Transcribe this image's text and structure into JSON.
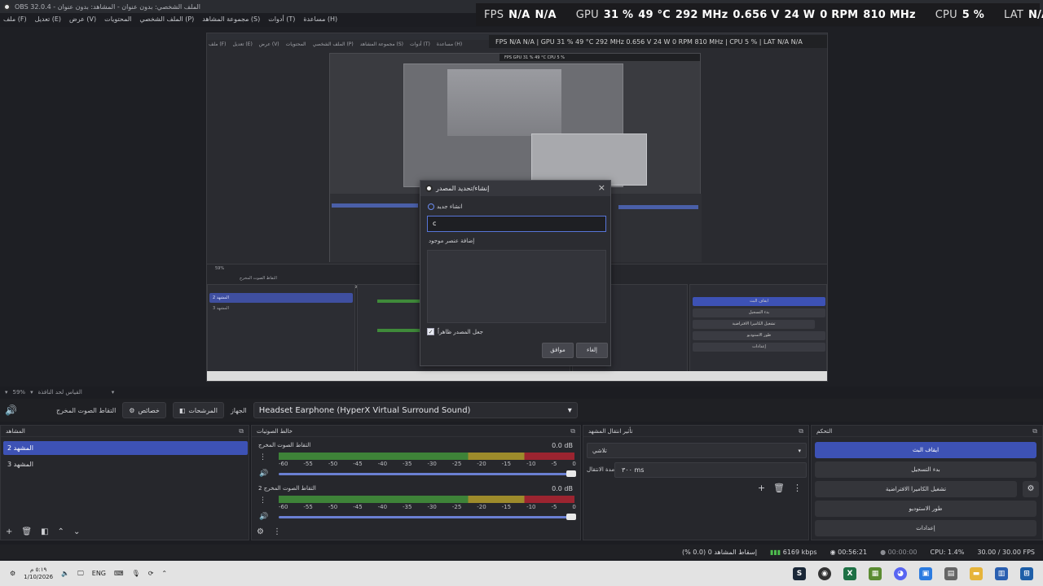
{
  "window": {
    "title": "OBS 32.0.4 - الملف الشخصي: بدون عنوان - المشاهد: بدون عنوان"
  },
  "menu": [
    "ملف (F)",
    "تعديل (E)",
    "عرض (V)",
    "المحتويات",
    "الملف الشخصي (P)",
    "مجموعة المشاهد (S)",
    "أدوات (T)",
    "مساعدة (H)"
  ],
  "overlay": {
    "fps_label": "FPS",
    "fps_val1": "N/A",
    "fps_val2": "N/A",
    "gpu_label": "GPU",
    "gpu_util": "31 %",
    "gpu_temp": "49 °C",
    "gpu_clock": "292 MHz",
    "gpu_volt": "0.656 V",
    "gpu_power": "24 W",
    "gpu_fan": "0 RPM",
    "gpu_mem": "810 MHz",
    "cpu_label": "CPU",
    "cpu_util": "5 %",
    "lat_label": "LAT",
    "lat_val1": "N/A",
    "lat_val2": "N/A"
  },
  "dialog": {
    "title": "إنشاء/تحديد المصدر",
    "close": "×",
    "create_new": "انشاء جديد",
    "name_value": "c",
    "add_existing": "إضافة عنصر موجود",
    "make_visible": "جعل المصدر ظاهراً",
    "ok": "موافق",
    "cancel": "إلغاء"
  },
  "zoom": {
    "percent": "59%",
    "scale_label": "القياس لحد النافذة"
  },
  "context": {
    "source_label": "التقاط الصوت المخرج",
    "properties": "خصائص",
    "filters": "المرشحات",
    "device_label": "الجهاز",
    "device_value": "Headset Earphone (HyperX Virtual Surround Sound)"
  },
  "scenes": {
    "title": "المشاهد",
    "items": [
      "المشهد 2",
      "المشهد 3"
    ]
  },
  "mixer": {
    "title": "خالط الصوتيات",
    "strips": [
      {
        "name": "التقاط الصوت المخرج",
        "db": "0.0 dB"
      },
      {
        "name": "التقاط الصوت المخرج 2",
        "db": "0.0 dB"
      }
    ],
    "scale": [
      "-60",
      "-55",
      "-50",
      "-45",
      "-40",
      "-35",
      "-30",
      "-25",
      "-20",
      "-15",
      "-10",
      "-5",
      "0"
    ]
  },
  "transitions": {
    "title": "تأثير انتقال المشهد",
    "type": "تلاشي",
    "duration_label": "مدة الانتقال",
    "duration_value": "٣٠٠ ms"
  },
  "controls": {
    "title": "التحكم",
    "buttons": [
      "ايقاف البث",
      "بدء التسجيل",
      "تشغيل الكاميرا الافتراضية",
      "طور الاستوديو",
      "إعدادات"
    ]
  },
  "status": {
    "dropped": "إسقاط المشاهد 0 (0.0 %)",
    "bitrate": "6169 kbps",
    "stream_time": "00:56:21",
    "rec_time": "00:00:00",
    "cpu": "CPU: 1.4%",
    "fps": "30.00 / 30.00 FPS"
  },
  "taskbar": {
    "time": "٥:١٩ م",
    "date": "1/10/2026",
    "lang": "ENG"
  },
  "colors": {
    "accent": "#3d52b5",
    "meter_green": "#3e8338",
    "meter_yellow": "#9d8b2b",
    "meter_red": "#9b2430"
  }
}
